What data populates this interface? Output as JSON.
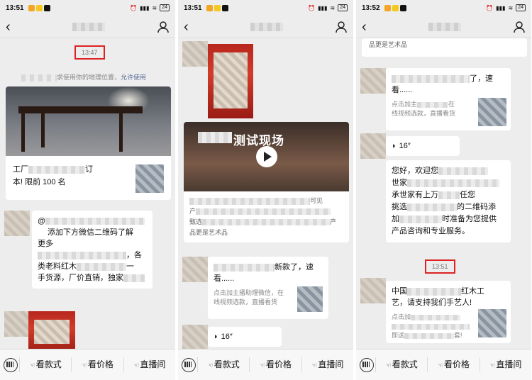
{
  "status": {
    "left_time": "13:51",
    "mid_time": "13:51",
    "right_time": "13:52",
    "battery": "24"
  },
  "bottom_menu": {
    "item1": "看款式",
    "item2": "看价格",
    "item3": "直播间"
  },
  "panel1": {
    "timestamp": "13:47",
    "location_text": "求使用你的地理位置，",
    "location_link": "允许使用",
    "card_line1_a": "工厂",
    "card_line1_b": "订",
    "card_line2": "本! 限前 100 名",
    "msg_at": "@",
    "msg_line1": "添加下方微信二维码了解",
    "msg_line2": "更多",
    "msg_line3": "，各",
    "msg_line4_a": "类老料红木",
    "msg_line4_b": "一",
    "msg_line5_a": "手货源，厂价直销，独家",
    "msg_line5_b": ""
  },
  "panel2": {
    "video_title": "测试现场",
    "desc_line1_b": "可见",
    "desc_line2_a": "产",
    "desc_line3_a": "甄选",
    "desc_line3_b": "产",
    "desc_line4": "品更是艺术品",
    "mini_line1_b": "新款了，速",
    "mini_line2": "看......",
    "mini_sub1": "点击加主播助理微信，在",
    "mini_sub2": "线视频选款，直播看货",
    "voice_duration": "16″"
  },
  "panel3": {
    "top_text": "品更是艺术品",
    "mini_line1_b": "了，速",
    "mini_line2": "看......",
    "mini_sub1": "点击加主",
    "mini_sub1_b": "在",
    "mini_sub2": "线视频选款，直播看货",
    "voice_duration": "16″",
    "long_line1": "您好，欢迎您",
    "long_line2": "世家",
    "long_line3": "承世家有上万",
    "long_line3_b": "任您",
    "long_line4": "挑选",
    "long_line4_b": "的二维码添",
    "long_line5": "加",
    "long_line5_b": "时准备为您提供",
    "long_line6": "产品咨询和专业服务。",
    "timestamp2": "13:51",
    "last_line1_a": "中国",
    "last_line1_b": "红木工",
    "last_line2": "艺，请支持我们手艺人!",
    "last_sub1": "点击加",
    "last_sub2": "即送",
    "last_sub2_b": "套!"
  }
}
